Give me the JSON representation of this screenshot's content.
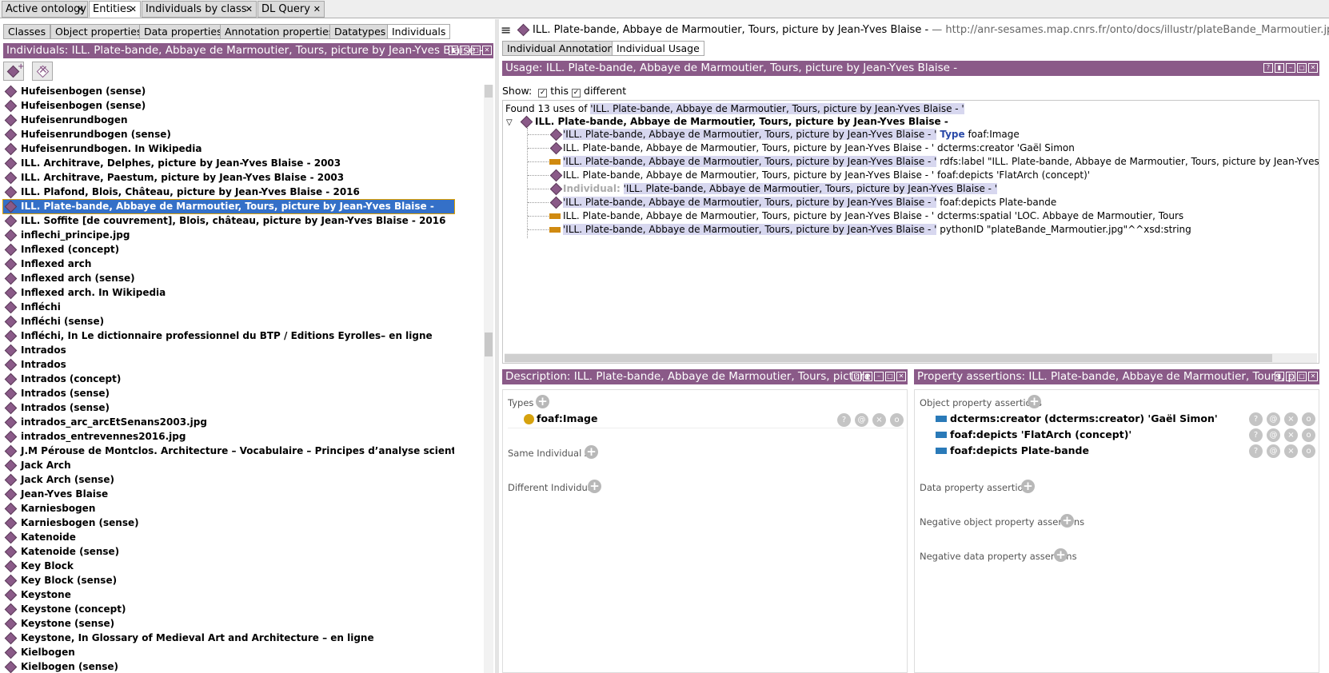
{
  "top_tabs": [
    "Active ontology",
    "Entities",
    "Individuals by class",
    "DL Query"
  ],
  "entity_tabs": [
    "Classes",
    "Object properties",
    "Data properties",
    "Annotation properties",
    "Datatypes",
    "Individuals"
  ],
  "left_panel": {
    "header": "Individuals: ILL. Plate-bande,  Abbaye de Marmoutier, Tours, picture by Jean-Yves Blaise -",
    "add_icon": "add-individual-icon",
    "delete_icon": "delete-individual-icon",
    "items": [
      "Hufeisenbogen (sense)",
      "Hufeisenbogen (sense)",
      "Hufeisenrundbogen",
      "Hufeisenrundbogen (sense)",
      "Hufeisenrundbogen. In Wikipedia",
      "ILL. Architrave, Delphes, picture by Jean-Yves Blaise - 2003",
      "ILL. Architrave, Paestum, picture by Jean-Yves Blaise - 2003",
      "ILL. Plafond, Blois, Château, picture by Jean-Yves Blaise - 2016",
      "ILL. Plate-bande, Abbaye de Marmoutier, Tours, picture by Jean-Yves Blaise -",
      "ILL. Soffite [de couvrement], Blois, château, picture by Jean-Yves Blaise - 2016",
      "inflechi_principe.jpg",
      "Inflexed (concept)",
      "Inflexed arch",
      "Inflexed arch (sense)",
      "Inflexed arch. In Wikipedia",
      "Infléchi",
      "Infléchi (sense)",
      "Infléchi, In Le dictionnaire professionnel du BTP / Editions Eyrolles– en ligne",
      "Intrados",
      "Intrados",
      "Intrados (concept)",
      "Intrados (sense)",
      "Intrados (sense)",
      "intrados_arc_arcEtSenans2003.jpg",
      "intrados_entrevennes2016.jpg",
      "J.M Pérouse de Montclos. Architecture – Vocabulaire – Principes d’analyse scientifique Paris Imprimerie",
      "Jack Arch",
      "Jack Arch (sense)",
      "Jean-Yves Blaise",
      "Karniesbogen",
      "Karniesbogen (sense)",
      "Katenoide",
      "Katenoide (sense)",
      "Key Block",
      "Key Block (sense)",
      "Keystone",
      "Keystone (concept)",
      "Keystone (sense)",
      "Keystone, In Glossary of Medieval Art and Architecture – en ligne",
      "Kielbogen",
      "Kielbogen (sense)"
    ],
    "selected_index": 8
  },
  "entity_title": {
    "name": "ILL. Plate-bande,  Abbaye de Marmoutier, Tours, picture by Jean-Yves Blaise -",
    "iri": "— http://anr-sesames.map.cnrs.fr/onto/docs/illustr/plateBande_Marmoutier.jpg"
  },
  "individual_tabs": [
    "Individual Annotations",
    "Individual Usage"
  ],
  "usage": {
    "header": "Usage: ILL. Plate-bande,  Abbaye de Marmoutier, Tours, picture by Jean-Yves Blaise -",
    "show_label": "Show:",
    "this_label": "this",
    "different_label": "different",
    "found_prefix": "Found 13 uses of",
    "found_entity": "'ILL. Plate-bande,  Abbaye de Marmoutier, Tours, picture by Jean-Yves Blaise - '",
    "root": "ILL. Plate-bande,  Abbaye de Marmoutier, Tours, picture by Jean-Yves Blaise -",
    "lines": [
      {
        "icon": "diamond",
        "subject": "'ILL. Plate-bande,  Abbaye de Marmoutier, Tours, picture by Jean-Yves Blaise - '",
        "hl": true,
        "kw": "Type",
        "rest": " foaf:Image"
      },
      {
        "icon": "diamond",
        "subject": "ILL. Plate-bande,  Abbaye de Marmoutier, Tours, picture by Jean-Yves Blaise - '",
        "hl": false,
        "kw": "",
        "rest": " dcterms:creator 'Gaël Simon"
      },
      {
        "icon": "bar",
        "subject": "'ILL. Plate-bande,  Abbaye de Marmoutier, Tours, picture by Jean-Yves Blaise - '",
        "hl": true,
        "kw": "",
        "rest": " rdfs:label \"ILL. Plate-bande,  Abbaye de Marmoutier, Tours, picture by Jean-Yves Blaise - \"^^xsd:"
      },
      {
        "icon": "diamond",
        "subject": "ILL. Plate-bande,  Abbaye de Marmoutier, Tours, picture by Jean-Yves Blaise - '",
        "hl": false,
        "kw": "",
        "rest": " foaf:depicts 'FlatArch (concept)'"
      },
      {
        "icon": "diamond",
        "subject": "'ILL. Plate-bande,  Abbaye de Marmoutier, Tours, picture by Jean-Yves Blaise - '",
        "hl": true,
        "kw": "Individual:",
        "rest": "",
        "kwfirst": true
      },
      {
        "icon": "diamond",
        "subject": "'ILL. Plate-bande,  Abbaye de Marmoutier, Tours, picture by Jean-Yves Blaise - '",
        "hl": true,
        "kw": "",
        "rest": " foaf:depicts Plate-bande"
      },
      {
        "icon": "bar",
        "subject": "ILL. Plate-bande,  Abbaye de Marmoutier, Tours, picture by Jean-Yves Blaise - '",
        "hl": false,
        "kw": "",
        "rest": " dcterms:spatial 'LOC. Abbaye de Marmoutier, Tours"
      },
      {
        "icon": "bar",
        "subject": "'ILL. Plate-bande,  Abbaye de Marmoutier, Tours, picture by Jean-Yves Blaise - '",
        "hl": true,
        "kw": "",
        "rest": " pythonID \"plateBande_Marmoutier.jpg\"^^xsd:string"
      }
    ]
  },
  "description": {
    "header": "Description: ILL. Plate-bande,  Abbaye de Marmoutier, Tours, picture",
    "types_label": "Types",
    "type_value": "foaf:Image",
    "same_label": "Same Individual As",
    "different_label": "Different Individuals"
  },
  "assertions": {
    "header": "Property assertions: ILL. Plate-bande,  Abbaye de Marmoutier, Tours, p",
    "object_label": "Object property assertions",
    "rows": [
      "dcterms:creator (dcterms:creator)  'Gaël Simon'",
      "foaf:depicts  'FlatArch (concept)'",
      "foaf:depicts  Plate-bande"
    ],
    "data_label": "Data property assertions",
    "neg_object_label": "Negative object property assertions",
    "neg_data_label": "Negative data property assertions"
  },
  "row_buttons": [
    "?",
    "@",
    "×",
    "o"
  ],
  "colors": {
    "purple": "#8a5a88",
    "selection": "#3470c8",
    "highlight": "#d7d7ef",
    "orange": "#d08a10",
    "blue": "#2a7ab8"
  }
}
